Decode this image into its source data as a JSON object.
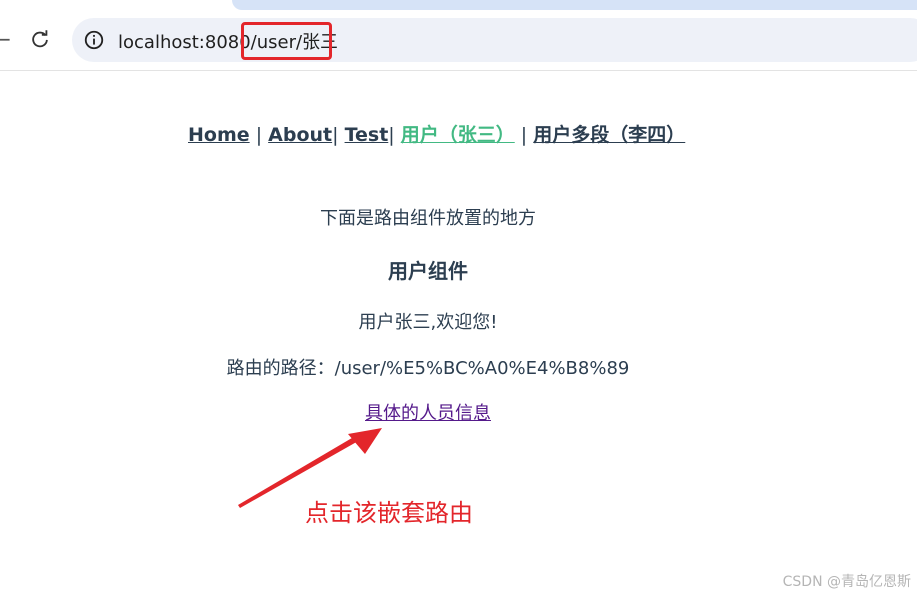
{
  "browser": {
    "url": "localhost:8080/user/张三",
    "back_icon": "back-arrow-icon",
    "reload_icon": "reload-icon",
    "info_icon": "info-icon"
  },
  "nav": {
    "items": [
      {
        "label": "Home",
        "active": false
      },
      {
        "label": "About",
        "active": false
      },
      {
        "label": "Test",
        "active": false
      },
      {
        "label": "用户（张三）",
        "active": true
      },
      {
        "label": "用户多段（李四）",
        "active": false
      }
    ],
    "separator": "|"
  },
  "main": {
    "router_caption": "下面是路由组件放置的地方",
    "component_title": "用户组件",
    "welcome": "用户张三,欢迎您!",
    "route_path": "路由的路径：/user/%E5%BC%A0%E4%B8%89",
    "detail_link": "具体的人员信息"
  },
  "annotation": {
    "text": "点击该嵌套路由",
    "color": "#e3262b"
  },
  "watermark": "CSDN @青岛亿恩斯",
  "colors": {
    "active_link": "#42b983",
    "text": "#2c3e50",
    "visited_link": "#551a8b",
    "highlight": "#e3262b"
  }
}
